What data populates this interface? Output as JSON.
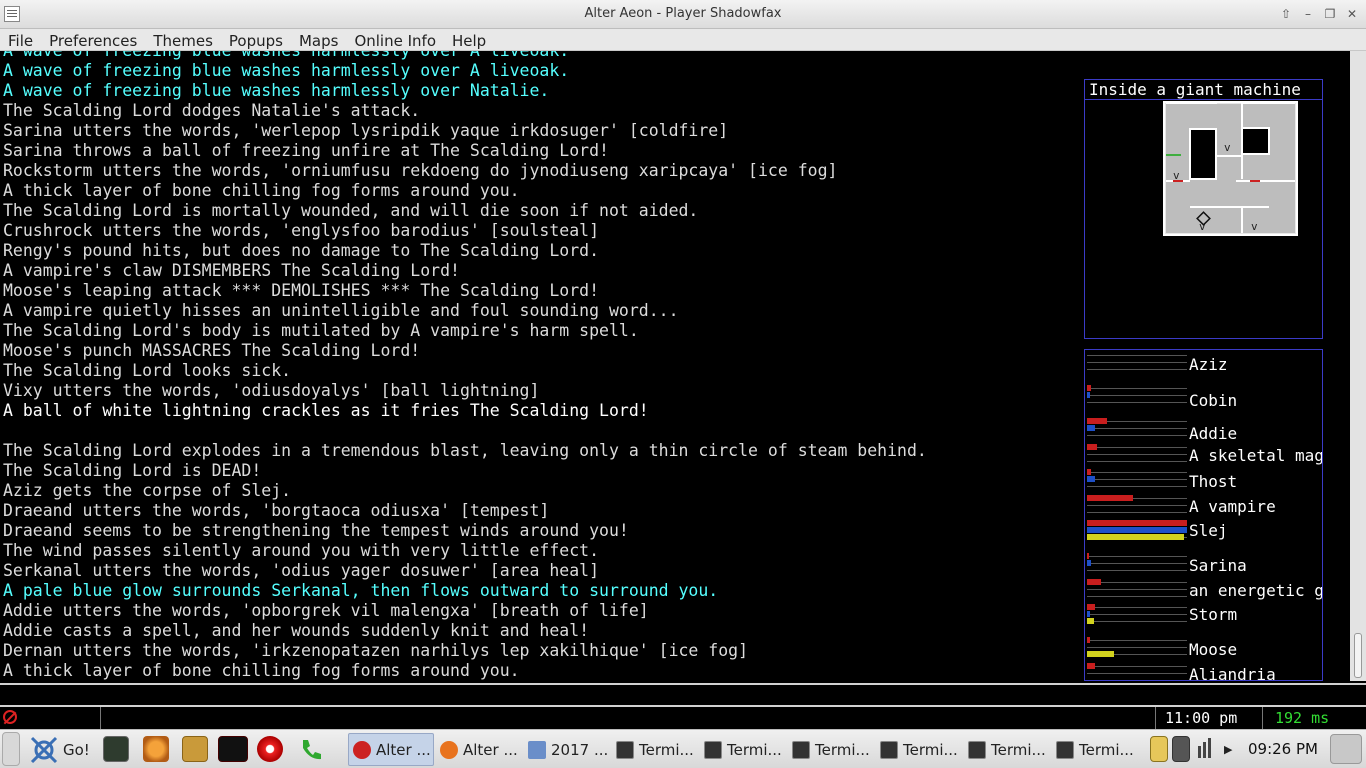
{
  "window": {
    "title": "Alter Aeon - Player Shadowfax",
    "buttons": [
      "⇧",
      "–",
      "❐",
      "✕"
    ]
  },
  "menu": [
    "File",
    "Preferences",
    "Themes",
    "Popups",
    "Maps",
    "Online Info",
    "Help"
  ],
  "output_lines": [
    {
      "text": "A wave of freezing blue washes harmlessly over A liveoak.",
      "color": "cyan"
    },
    {
      "text": "A wave of freezing blue washes harmlessly over A liveoak.",
      "color": "cyan"
    },
    {
      "text": "A wave of freezing blue washes harmlessly over Natalie.",
      "color": "cyan"
    },
    {
      "text": "The Scalding Lord dodges Natalie's attack.",
      "color": "grey"
    },
    {
      "text": "Sarina utters the words, 'werlepop lysripdik yaque irkdosuger' [coldfire]",
      "color": "grey"
    },
    {
      "text": "Sarina throws a ball of freezing unfire at The Scalding Lord!",
      "color": "grey"
    },
    {
      "text": "Rockstorm utters the words, 'orniumfusu rekdoeng do jynodiuseng xaripcaya' [ice fog]",
      "color": "grey"
    },
    {
      "text": "A thick layer of bone chilling fog forms around you.",
      "color": "grey"
    },
    {
      "text": "The Scalding Lord is mortally wounded, and will die soon if not aided.",
      "color": "grey"
    },
    {
      "text": "Crushrock utters the words, 'englysfoo barodius' [soulsteal]",
      "color": "grey"
    },
    {
      "text": "Rengy's pound hits, but does no damage to The Scalding Lord.",
      "color": "grey"
    },
    {
      "text": "A vampire's claw DISMEMBERS The Scalding Lord!",
      "color": "grey"
    },
    {
      "text": "Moose's leaping attack *** DEMOLISHES *** The Scalding Lord!",
      "color": "grey"
    },
    {
      "text": "A vampire quietly hisses an unintelligible and foul sounding word...",
      "color": "grey"
    },
    {
      "text": "The Scalding Lord's body is mutilated by A vampire's harm spell.",
      "color": "grey"
    },
    {
      "text": "Moose's punch MASSACRES The Scalding Lord!",
      "color": "grey"
    },
    {
      "text": "The Scalding Lord looks sick.",
      "color": "grey"
    },
    {
      "text": "Vixy utters the words, 'odiusdoyalys' [ball lightning]",
      "color": "grey"
    },
    {
      "text": "A ball of white lightning crackles as it fries The Scalding Lord!",
      "color": "white"
    },
    {
      "text": "",
      "color": "grey"
    },
    {
      "text": "The Scalding Lord explodes in a tremendous blast, leaving only a thin circle of steam behind.",
      "color": "grey"
    },
    {
      "text": "The Scalding Lord is DEAD!",
      "color": "grey"
    },
    {
      "text": "Aziz gets the corpse of Slej.",
      "color": "grey"
    },
    {
      "text": "Draeand utters the words, 'borgtaoca odiusxa' [tempest]",
      "color": "grey"
    },
    {
      "text": "Draeand seems to be strengthening the tempest winds around you!",
      "color": "grey"
    },
    {
      "text": "The wind passes silently around you with very little effect.",
      "color": "grey"
    },
    {
      "text": "Serkanal utters the words, 'odius yager dosuwer' [area heal]",
      "color": "grey"
    },
    {
      "text": "A pale blue glow surrounds Serkanal, then flows outward to surround you.",
      "color": "cyan"
    },
    {
      "text": "Addie utters the words, 'opborgrek vil malengxa' [breath of life]",
      "color": "grey"
    },
    {
      "text": "Addie casts a spell, and her wounds suddenly knit and heal!",
      "color": "grey"
    },
    {
      "text": "Dernan utters the words, 'irkzenopatazen narhilys lep xakilhique' [ice fog]",
      "color": "grey"
    },
    {
      "text": "A thick layer of bone chilling fog forms around you.",
      "color": "grey"
    }
  ],
  "map": {
    "title": "Inside a giant machine"
  },
  "group": [
    {
      "name": "Aziz",
      "bars": [
        0,
        0,
        0
      ]
    },
    {
      "name": "Cobin",
      "bars": [
        0.04,
        0.03,
        0
      ]
    },
    {
      "name": "Addie",
      "bars": [
        0.2,
        0.08,
        0
      ]
    },
    {
      "name": "A skeletal mage",
      "bars": [
        0.1,
        0,
        0
      ]
    },
    {
      "name": "Thost",
      "bars": [
        0.04,
        0.08,
        0
      ]
    },
    {
      "name": "A vampire",
      "bars": [
        0.46,
        0,
        0
      ]
    },
    {
      "name": "Slej",
      "bars": [
        1.0,
        1.0,
        0.97
      ]
    },
    {
      "name": "Sarina",
      "bars": [
        0.02,
        0.04,
        0
      ]
    },
    {
      "name": "an energetic golem",
      "bars": [
        0.14,
        0,
        0
      ]
    },
    {
      "name": "Storm",
      "bars": [
        0.08,
        0.03,
        0.07
      ]
    },
    {
      "name": "Moose",
      "bars": [
        0.03,
        0,
        0.27
      ]
    },
    {
      "name": "Aliandria",
      "bars": [
        0.08,
        0,
        0
      ]
    }
  ],
  "input": {
    "value": ""
  },
  "status": {
    "time": "11:00 pm",
    "lag": "192 ms"
  },
  "taskbar": {
    "start_label": "Go!",
    "windows": [
      {
        "label": "Alter ...",
        "icon": "alteraeon-icon",
        "active": true
      },
      {
        "label": "Alter ...",
        "icon": "firefox-icon",
        "active": false
      },
      {
        "label": "2017 ...",
        "icon": "folder-icon",
        "active": false
      },
      {
        "label": "Termi...",
        "icon": "terminal-icon",
        "active": false
      },
      {
        "label": "Termi...",
        "icon": "terminal-icon",
        "active": false
      },
      {
        "label": "Termi...",
        "icon": "terminal-icon",
        "active": false
      },
      {
        "label": "Termi...",
        "icon": "terminal-icon",
        "active": false
      },
      {
        "label": "Termi...",
        "icon": "terminal-icon",
        "active": false
      },
      {
        "label": "Termi...",
        "icon": "terminal-icon",
        "active": false
      }
    ],
    "clock": "09:26 PM"
  },
  "colors": {
    "cyan": "#55ffff",
    "grey": "#dcdcdc",
    "white": "#ffffff",
    "hp_bar": "#c81e1e",
    "mana_bar": "#1e50c8",
    "move_bar": "#d2d21e",
    "panel_border": "#3b3bc7",
    "lag_green": "#33dd33"
  }
}
